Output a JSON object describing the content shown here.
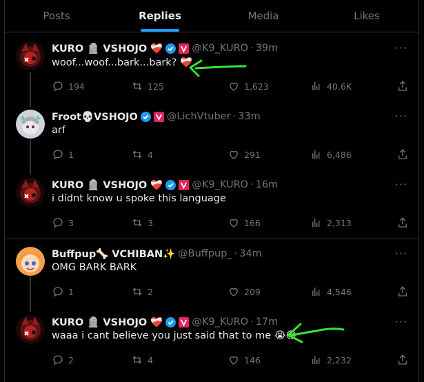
{
  "tabs": [
    {
      "label": "Posts",
      "active": false
    },
    {
      "label": "Replies",
      "active": true
    },
    {
      "label": "Media",
      "active": false
    },
    {
      "label": "Likes",
      "active": false
    }
  ],
  "posts": [
    {
      "name": "KURO 🪦 VSHOJO ❤️‍🩹",
      "handle": "@K9_KURO",
      "time": "39m",
      "text": "woof...woof...bark...bark? ❤️‍🩹",
      "replies": "194",
      "reposts": "125",
      "likes": "1,623",
      "views": "40.6K"
    },
    {
      "name": "Froot💀VSHOJO",
      "handle": "@LichVtuber",
      "time": "33m",
      "text": "arf",
      "replies": "1",
      "reposts": "4",
      "likes": "291",
      "views": "6,486"
    },
    {
      "name": "KURO 🪦 VSHOJO ❤️‍🩹",
      "handle": "@K9_KURO",
      "time": "16m",
      "text": "i didnt know u spoke this language",
      "replies": "3",
      "reposts": "3",
      "likes": "166",
      "views": "2,313"
    },
    {
      "name": "Buffpup🦴 VCHIBAN✨",
      "handle": "@Buffpup_",
      "time": "34m",
      "text": "OMG BARK BARK",
      "replies": "1",
      "reposts": "2",
      "likes": "209",
      "views": "4,546"
    },
    {
      "name": "KURO 🪦 VSHOJO ❤️‍🩹",
      "handle": "@K9_KURO",
      "time": "17m",
      "text": "waaa i cant believe you just said that to me 😭😢",
      "replies": "2",
      "reposts": "4",
      "likes": "146",
      "views": "2,232"
    }
  ],
  "colors": {
    "accent": "#1d9bf0",
    "annotation": "#35e835"
  }
}
